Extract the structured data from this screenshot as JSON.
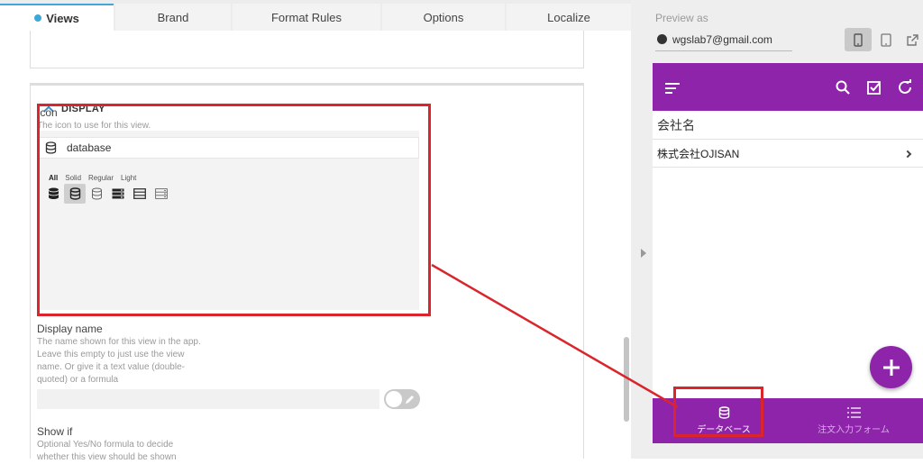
{
  "tabs": [
    {
      "label": "Views",
      "active": true
    },
    {
      "label": "Brand"
    },
    {
      "label": "Format Rules"
    },
    {
      "label": "Options"
    },
    {
      "label": "Localize"
    }
  ],
  "display_section": {
    "title": "DISPLAY",
    "icon_field": {
      "label": "Icon",
      "help": "The icon to use for this view.",
      "value": "database",
      "icon": "database-icon",
      "filters": [
        "All",
        "Solid",
        "Regular",
        "Light"
      ],
      "active_filter": "All",
      "options": [
        "database-solid-icon",
        "database-solid-selected-icon",
        "database-regular-icon",
        "server-solid-icon",
        "server-regular-icon",
        "server-light-icon"
      ]
    },
    "display_name": {
      "label": "Display name",
      "help": [
        "The name shown for this view in the app.",
        "Leave this empty to just use the view",
        "name. Or give it a text value (double-",
        "quoted) or a formula"
      ],
      "value": ""
    },
    "show_if": {
      "label": "Show if",
      "help": [
        "Optional Yes/No formula to decide",
        "whether this view should be shown"
      ]
    }
  },
  "preview": {
    "label": "Preview as",
    "account": "wgslab7@gmail.com",
    "devices": [
      "phone-icon",
      "tablet-icon",
      "external-link-icon"
    ],
    "active_device": "phone-icon",
    "app": {
      "colors": {
        "primary": "#8e24aa"
      },
      "appbar_icons": [
        "menu-icon",
        "search-icon",
        "check-square-icon",
        "refresh-icon"
      ],
      "column_header": "会社名",
      "rows": [
        {
          "text": "株式会社OJISAN"
        }
      ],
      "fab": "plus-icon",
      "nav": [
        {
          "label": "データベース",
          "icon": "database-icon",
          "active": true
        },
        {
          "label": "注文入力フォーム",
          "icon": "list-icon",
          "active": false
        }
      ]
    }
  },
  "annotation_color": "#d9252b"
}
